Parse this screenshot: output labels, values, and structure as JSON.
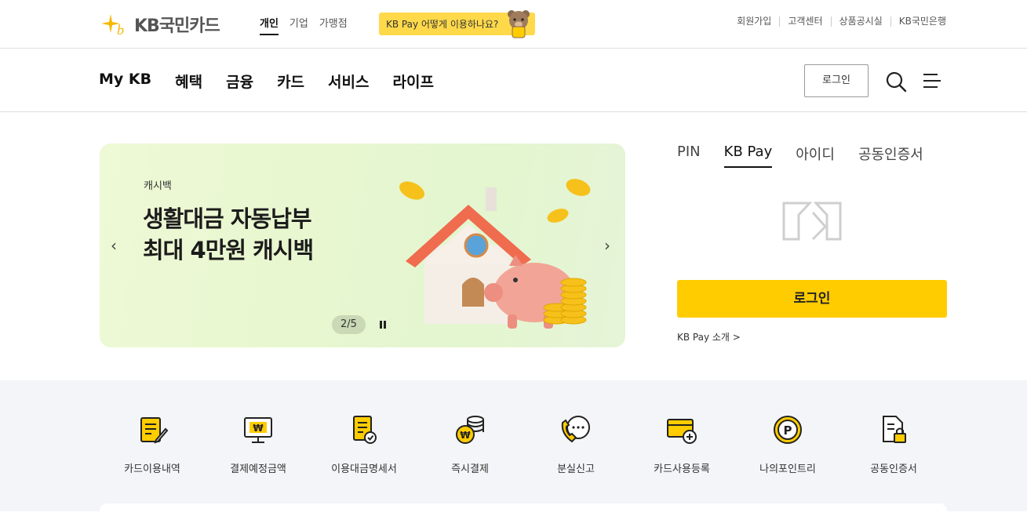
{
  "brand": {
    "name": "KB국민카드",
    "accent": "#ffcc00",
    "logo_mark_color": "#f5b800"
  },
  "top_tabs": [
    {
      "label": "개인",
      "active": true
    },
    {
      "label": "기업",
      "active": false
    },
    {
      "label": "가맹점",
      "active": false
    }
  ],
  "pay_banner": {
    "label": "KB Pay 어떻게 이용하나요?"
  },
  "util_links": [
    "회원가입",
    "고객센터",
    "상품공시실",
    "KB국민은행"
  ],
  "gnb": {
    "menu": [
      "My KB",
      "혜택",
      "금융",
      "카드",
      "서비스",
      "라이프"
    ],
    "login_label": "로그인",
    "search_icon": "search-icon",
    "menu_icon": "hamburger-icon"
  },
  "hero": {
    "category": "캐시백",
    "title_line1": "생활대금 자동납부",
    "title_line2": "최대 4만원 캐시백",
    "counter": "2/5",
    "prev_glyph": "‹",
    "next_glyph": "›",
    "bg_color": "#e8f7d0"
  },
  "login_panel": {
    "tabs": [
      {
        "label": "PIN",
        "active": false
      },
      {
        "label": "KB Pay",
        "active": true
      },
      {
        "label": "아이디",
        "active": false
      },
      {
        "label": "공동인증서",
        "active": false
      }
    ],
    "login_button": "로그인",
    "intro_link": "KB Pay 소개 >"
  },
  "quick_menu": [
    {
      "label": "카드이용내역",
      "icon": "document-pen-icon"
    },
    {
      "label": "결제예정금액",
      "icon": "monitor-won-icon"
    },
    {
      "label": "이용대금명세서",
      "icon": "statement-check-icon"
    },
    {
      "label": "즉시결제",
      "icon": "coin-stack-icon"
    },
    {
      "label": "분실신고",
      "icon": "phone-call-icon"
    },
    {
      "label": "카드사용등록",
      "icon": "card-plus-icon"
    },
    {
      "label": "나의포인트리",
      "icon": "point-coin-icon"
    },
    {
      "label": "공동인증서",
      "icon": "certificate-lock-icon"
    }
  ]
}
